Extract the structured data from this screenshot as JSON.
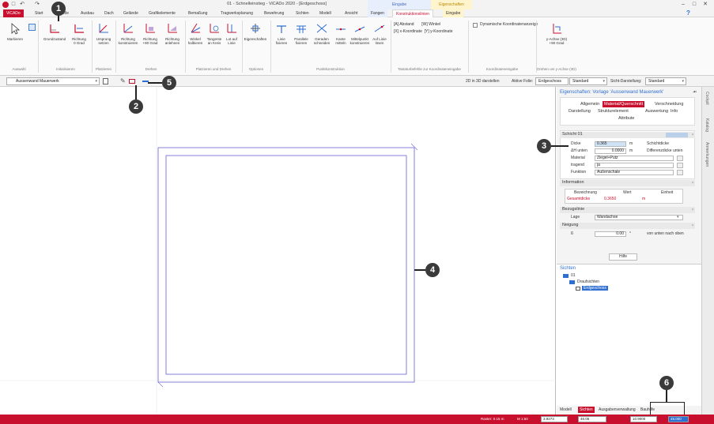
{
  "window": {
    "title": "01 - Schnelleinstieg - ViCADo 2020 - [Erdgeschoss]",
    "context_group_1": "Eingabe",
    "context_group_2": "Eigenschaften",
    "controls": [
      "–",
      "□",
      "✕"
    ],
    "help_glyph": "?"
  },
  "tabs": [
    {
      "label": "ViCADo"
    },
    {
      "label": "Start"
    },
    {
      "label": "Bauteile"
    },
    {
      "label": "Ausbau"
    },
    {
      "label": "Dach"
    },
    {
      "label": "Gelände"
    },
    {
      "label": "Grafikelemente"
    },
    {
      "label": "Bemaßung"
    },
    {
      "label": "Tragwerksplanung"
    },
    {
      "label": "Bewehrung"
    },
    {
      "label": "Sichten"
    },
    {
      "label": "Modell"
    },
    {
      "label": "Ansicht"
    },
    {
      "label": "Fangen"
    },
    {
      "label": "Konstruktionslinien"
    },
    {
      "label": "Eingabe"
    }
  ],
  "ribbon": {
    "buttons": [
      {
        "label": "Markieren"
      },
      {
        "label": "Grundzustand"
      },
      {
        "label": "Richtung\n0 Grad"
      },
      {
        "label": "Ursprung\nsetzen"
      },
      {
        "label": "Richtung\nkonstruieren"
      },
      {
        "label": "Richtung\n+90 Grad"
      },
      {
        "label": "Richtung\nanlehnen"
      },
      {
        "label": "Winkel\nhalbieren"
      },
      {
        "label": "Tangente\nan Kreis"
      },
      {
        "label": "Lot auf\nLinie"
      },
      {
        "label": "Eigenschaften"
      },
      {
        "label": "Linie\nfixieren"
      },
      {
        "label": "Parallele\nfixieren"
      },
      {
        "label": "Geraden\nschneiden"
      },
      {
        "label": "Kante\nmitteln"
      },
      {
        "label": "Mittelpunkt\nkonstruieren"
      },
      {
        "label": "Auf Linie\nlösen"
      },
      {
        "label": "y-Achse (3D)\n+90 Grad"
      }
    ],
    "groups": [
      "Auswahl",
      "Initialisieren",
      "Platzieren",
      "Drehen",
      "Platzieren und Drehen",
      "Optionen",
      "Punktkonstruktion",
      "Tastaturbefehle zur Koordinateneingabe",
      "Koordinateneingabe",
      "Drehen um y-Achse (3D)"
    ],
    "shortcuts": [
      "[A] Abstand       [W] Winkel",
      "[X] x-Koordinate  [Y] y-Koordinate"
    ],
    "checkbox_label": "Dynamische Koordinatenanzeige"
  },
  "toolbar": {
    "element_type": "Aussenwand Mauerwerk",
    "show_3d": "2D in 3D darstellen",
    "active_foil_label": "Aktive Folie:",
    "active_foil_value": "Erdgeschoss",
    "foil_style": "Standard",
    "view_style_label": "Sicht-Darstellung:",
    "view_style_value": "Standard"
  },
  "properties": {
    "title": "Eigenschaften: Vorlage 'Aussenwand Mauerwerk'",
    "tabs_row1": [
      "Allgemein",
      "Material/Querschnitt",
      "Verschneidung"
    ],
    "tabs_row2": [
      "Darstellung",
      "Strukturelement",
      "Auswertung",
      "Info"
    ],
    "tabs_row3": [
      "Attribute"
    ],
    "layer": {
      "header": "Schicht 01",
      "rows": [
        {
          "label": "Dicke",
          "value": "0.365",
          "unit": "m",
          "desc": "Schichtdicke"
        },
        {
          "label": "ΔH unten",
          "value": "0.0000",
          "unit": "m",
          "desc": "Differenzdicke unten"
        },
        {
          "label": "Material",
          "value": "Ziegel+Putz"
        },
        {
          "label": "tragend",
          "value": "ja"
        },
        {
          "label": "Funktion",
          "value": "Außenschale"
        }
      ]
    },
    "information": {
      "header": "Information",
      "columns": [
        "Bezeichnung",
        "Wert",
        "Einheit"
      ],
      "row": [
        "Gesamtdicke",
        "0.3650",
        "m"
      ]
    },
    "bezugslinie": {
      "header": "Bezugslinie",
      "label": "Lage",
      "value": "Wandachse"
    },
    "neigung": {
      "header": "Neigung",
      "label": "ß",
      "value": "0.00",
      "unit": "°",
      "desc": "von unten nach oben"
    },
    "help_button": "Hilfe"
  },
  "views": {
    "header": "Sichten",
    "tree": [
      "01",
      "Draufsichten",
      "Erdgeschoss"
    ]
  },
  "side_tabs": [
    "Cockpit",
    "Katalog",
    "Anmerkungen"
  ],
  "bottom_tabs": [
    "Modell",
    "Sichten",
    "Ausgabenverwaltung",
    "Bauhilfe"
  ],
  "status": {
    "items": [
      "Raster: 0.15 m",
      "M 1:50"
    ],
    "coords": [
      "3.9273",
      "46.05",
      "10.9000",
      "45.000"
    ]
  },
  "callouts": [
    "1",
    "2",
    "3",
    "4",
    "5",
    "6"
  ],
  "colors": {
    "brand_red": "#c8102e",
    "wall_line": "#7b72d6",
    "context_tab": "#fff4cc"
  }
}
